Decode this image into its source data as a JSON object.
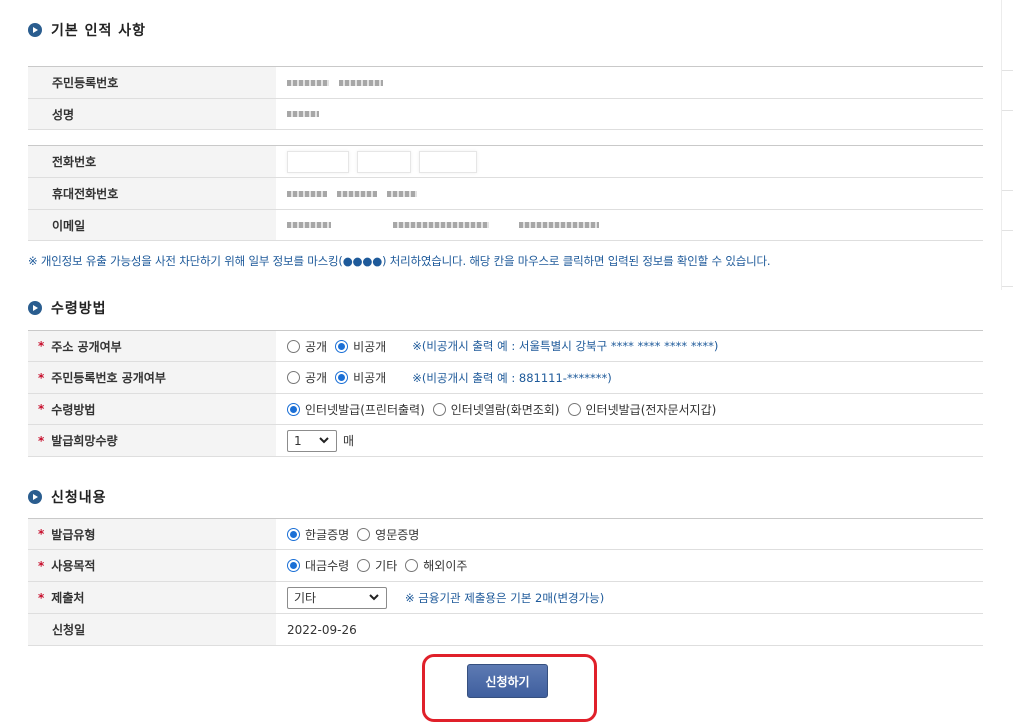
{
  "sections": {
    "basic": "기본 인적 사항",
    "receive": "수령방법",
    "apply": "신청내용"
  },
  "basic": {
    "rrn_label": "주민등록번호",
    "name_label": "성명",
    "phone_label": "전화번호",
    "mobile_label": "휴대전화번호",
    "email_label": "이메일"
  },
  "notice": "※ 개인정보 유출 가능성을 사전 차단하기 위해 일부 정보를 마스킹(●●●●) 처리하였습니다. 해당 칸을 마우스로 클릭하면 입력된 정보를 확인할 수 있습니다.",
  "receive": {
    "address_label": "주소 공개여부",
    "address_public": "공개",
    "address_private": "비공개",
    "address_hint": "※(비공개시 출력 예 : 서울특별시 강북구 **** **** **** ****)",
    "rrn_label": "주민등록번호 공개여부",
    "rrn_public": "공개",
    "rrn_private": "비공개",
    "rrn_hint": "※(비공개시 출력 예 : 881111-*******)",
    "method_label": "수령방법",
    "method_opt1": "인터넷발급(프린터출력)",
    "method_opt2": "인터넷열람(화면조회)",
    "method_opt3": "인터넷발급(전자문서지갑)",
    "qty_label": "발급희망수량",
    "qty_value": "1",
    "qty_unit": "매"
  },
  "apply": {
    "type_label": "발급유형",
    "type_opt1": "한글증명",
    "type_opt2": "영문증명",
    "purpose_label": "사용목적",
    "purpose_opt1": "대금수령",
    "purpose_opt2": "기타",
    "purpose_opt3": "해외이주",
    "submit_to_label": "제출처",
    "submit_to_value": "기타",
    "submit_to_hint": "※ 금융기관 제출용은 기본 2매(변경가능)",
    "date_label": "신청일",
    "date_value": "2022-09-26"
  },
  "required_mark": "*",
  "submit_label": "신청하기",
  "colors": {
    "accent": "#1e5a9a",
    "required": "#c8102e",
    "highlight": "#e0202a"
  }
}
